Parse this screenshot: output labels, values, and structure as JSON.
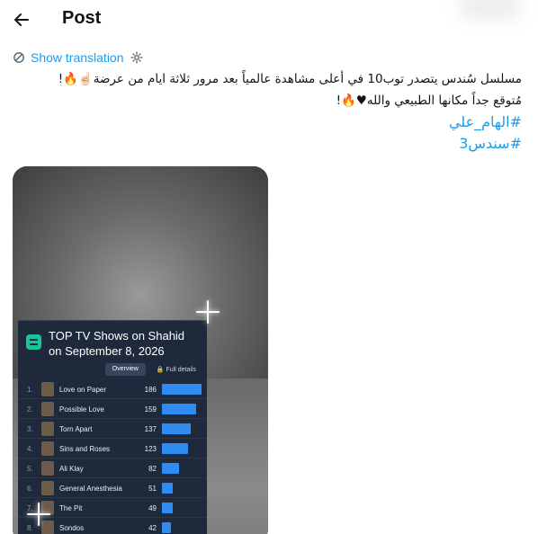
{
  "header": {
    "title": "Post"
  },
  "translation": {
    "link_label": "Show translation"
  },
  "post": {
    "line1": "مسلسل سُندس يتصدر توب10 في أعلى مشاهدة عالمياً بعد مرور ثلاثة ايام من عرضة☝🏻🔥!",
    "line2": "مُتوقع جداً مكانها الطبيعي والله♥🔥!",
    "hashtags": [
      "#الهام_علي",
      "#سندس3"
    ]
  },
  "media": {
    "chart": {
      "title_line1": "TOP TV Shows on Shahid",
      "title_line2": "on September 8, 2026",
      "tabs": [
        "Overview",
        "🔒 Full details"
      ],
      "rows": [
        {
          "rank": "1.",
          "title": "Love on Paper",
          "views": "186"
        },
        {
          "rank": "2.",
          "title": "Possible Love",
          "views": "159"
        },
        {
          "rank": "3.",
          "title": "Torn Apart",
          "views": "137"
        },
        {
          "rank": "4.",
          "title": "Sins and Roses",
          "views": "123"
        },
        {
          "rank": "5.",
          "title": "Ali Klay",
          "views": "82"
        },
        {
          "rank": "6.",
          "title": "General Anesthesia",
          "views": "51"
        },
        {
          "rank": "7.",
          "title": "The Pit",
          "views": "49"
        },
        {
          "rank": "8.",
          "title": "Sondos",
          "views": "42"
        }
      ],
      "bar_color": "#2f8cf0"
    }
  },
  "colors": {
    "accent": "#1d9bf0",
    "text": "#0f1419"
  }
}
